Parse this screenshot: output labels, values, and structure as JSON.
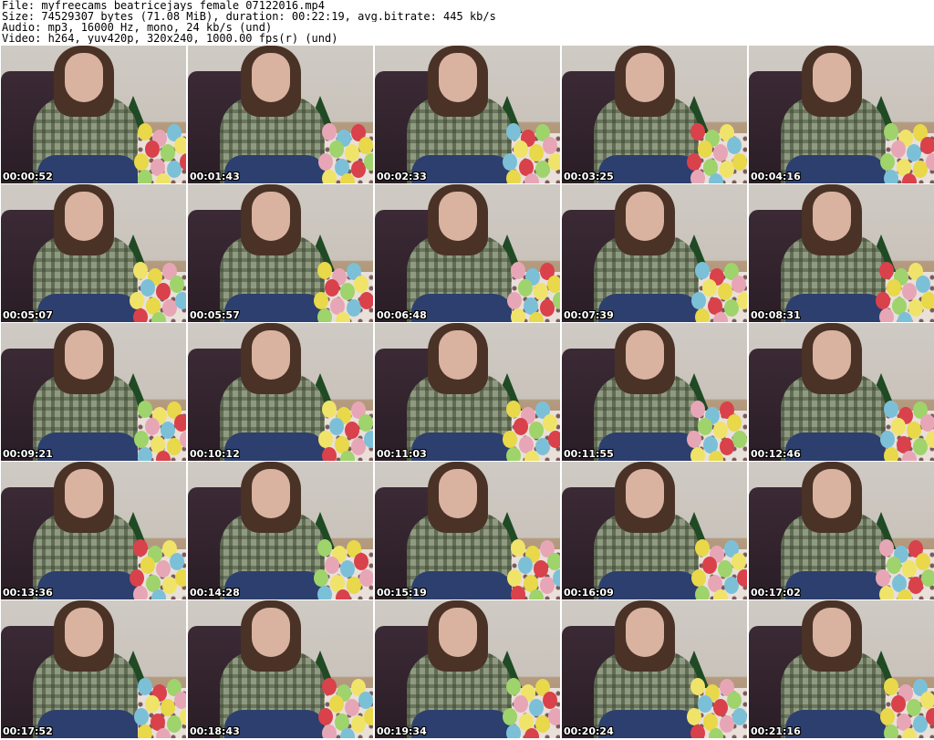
{
  "header": {
    "file_line": "File: myfreecams_beatricejays_female_07122016.mp4",
    "size_line": "Size: 74529307 bytes (71.08 MiB), duration: 00:22:19, avg.bitrate: 445 kb/s",
    "audio_line": "Audio: mp3, 16000 Hz, mono, 24 kb/s (und)",
    "video_line": "Video: h264, yuv420p, 320x240, 1000.00 fps(r) (und)"
  },
  "thumbnails": [
    {
      "timestamp": "00:00:52"
    },
    {
      "timestamp": "00:01:43"
    },
    {
      "timestamp": "00:02:33"
    },
    {
      "timestamp": "00:03:25"
    },
    {
      "timestamp": "00:04:16"
    },
    {
      "timestamp": "00:05:07"
    },
    {
      "timestamp": "00:05:57"
    },
    {
      "timestamp": "00:06:48"
    },
    {
      "timestamp": "00:07:39"
    },
    {
      "timestamp": "00:08:31"
    },
    {
      "timestamp": "00:09:21"
    },
    {
      "timestamp": "00:10:12"
    },
    {
      "timestamp": "00:11:03"
    },
    {
      "timestamp": "00:11:55"
    },
    {
      "timestamp": "00:12:46"
    },
    {
      "timestamp": "00:13:36"
    },
    {
      "timestamp": "00:14:28"
    },
    {
      "timestamp": "00:15:19"
    },
    {
      "timestamp": "00:16:09"
    },
    {
      "timestamp": "00:17:02"
    },
    {
      "timestamp": "00:17:52"
    },
    {
      "timestamp": "00:18:43"
    },
    {
      "timestamp": "00:19:34"
    },
    {
      "timestamp": "00:20:24"
    },
    {
      "timestamp": "00:21:16"
    }
  ],
  "colors": {
    "timestamp_text": "#ffffff",
    "timestamp_outline": "#000000",
    "balloon_palette": [
      "#e8d84a",
      "#e7a6b6",
      "#7cc0d8",
      "#d9414b",
      "#9fd36b",
      "#f0e36a"
    ]
  }
}
